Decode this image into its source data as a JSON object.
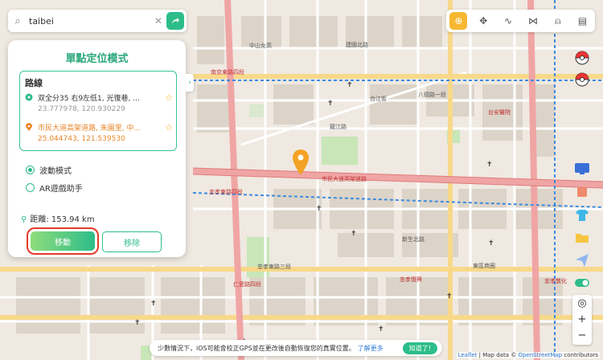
{
  "search": {
    "value": "taibei",
    "placeholder": ""
  },
  "panel": {
    "title": "單點定位模式",
    "route_title": "路線",
    "stops": [
      {
        "address": "双全分35 右9左低1, 光復巷, ...",
        "coords": "23.777978, 120.930229"
      },
      {
        "address": "市民大道高架道路, 朱園里, 中...",
        "coords": "25.044743, 121.539530"
      }
    ],
    "modes": [
      {
        "label": "波動模式",
        "selected": true
      },
      {
        "label": "AR遊戲助手",
        "selected": false
      }
    ],
    "distance_label": "距離: 153.94 km",
    "move_button": "移動",
    "remove_button": "移除"
  },
  "toolbar": {
    "icons": [
      "crosshair-icon",
      "move-icon",
      "route-icon",
      "multi-route-icon",
      "user-icon",
      "history-icon"
    ]
  },
  "notice": {
    "text": "少數情況下，iOS可能會校正GPS並在更改後自動恢復您的真實位置。",
    "link": "了解更多",
    "button": "知道了!"
  },
  "attribution": {
    "leaflet": "Leaflet",
    "text": " | Map data © ",
    "osm": "OpenStreetMap",
    "tail": " contributors"
  },
  "map_labels": {
    "l1": "南京東路四段",
    "l2": "市民大道高架道路",
    "l3": "忠孝東路四段",
    "l4": "忠孝東路三段",
    "l5": "八德路一段",
    "l6": "台安醫院",
    "l7": "東區商圈",
    "l8": "忠孝敦化",
    "l9": "忠孝復興",
    "l10": "仁愛路四段",
    "l11": "中山女高",
    "l12": "新生北路",
    "l13": "龍江路",
    "l14": "建國北路",
    "l15": "合江街"
  },
  "colors": {
    "accent": "#2dbd8a",
    "highlight": "#e23b2a",
    "toolbar_active": "#f7b731",
    "pin": "#f4a224"
  }
}
